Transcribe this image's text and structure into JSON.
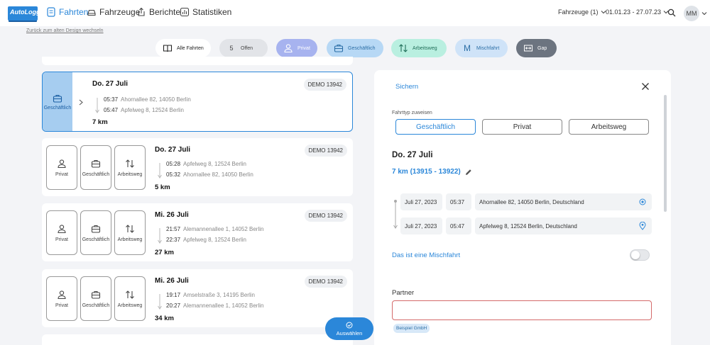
{
  "logo": "AutoLogg",
  "nav": {
    "trips": "Fahrten",
    "vehicles": "Fahrzeuge",
    "reports": "Berichte",
    "stats": "Statistiken"
  },
  "vehicle_filter": "Fahrzeuge (1)",
  "date_range": "01.01.23 - 27.07.23",
  "avatar": "MM",
  "old_design_link": "Zurück zum alten Design wechseln",
  "chips": {
    "all": "Alle Fahrten",
    "open_count": "5",
    "open": "Offen",
    "private": "Privat",
    "business": "Geschäftlich",
    "commute": "Arbeitsweg",
    "mixed_letter": "M",
    "mixed": "Mischfahrt",
    "gap": "Gap"
  },
  "trip_types": {
    "private": "Privat",
    "business": "Geschäftlich",
    "commute": "Arbeitsweg"
  },
  "trips": [
    {
      "date": "Do. 27 Juli",
      "plate": "DEMO 13942",
      "start_time": "05:37",
      "start_addr": "Ahornallee 82, 14050 Berlin",
      "end_time": "05:47",
      "end_addr": "Apfelweg 8, 12524 Berlin",
      "km": "7 km"
    },
    {
      "date": "Do. 27 Juli",
      "plate": "DEMO 13942",
      "start_time": "05:28",
      "start_addr": "Apfelweg 8, 12524 Berlin",
      "end_time": "05:32",
      "end_addr": "Ahornallee 82, 14050 Berlin",
      "km": "5 km"
    },
    {
      "date": "Mi. 26 Juli",
      "plate": "DEMO 13942",
      "start_time": "21:57",
      "start_addr": "Alemannenallee 1, 14052 Berlin",
      "end_time": "22:37",
      "end_addr": "Apfelweg 8, 12524 Berlin",
      "km": "27 km"
    },
    {
      "date": "Mi. 26 Juli",
      "plate": "DEMO 13942",
      "start_time": "19:17",
      "start_addr": "Amselstraße 3, 14195 Berlin",
      "end_time": "20:27",
      "end_addr": "Alemannenallee 1, 14052 Berlin",
      "km": "34 km"
    }
  ],
  "fab": "Auswählen",
  "panel": {
    "save": "Sichern",
    "assign_label": "Fahrttyp zuweisen",
    "date": "Do. 27 Juli",
    "km": "7 km (13915 - 13922)",
    "start_date": "Juli 27, 2023",
    "start_time": "05:37",
    "start_addr": "Ahornallee 82, 14050 Berlin, Deutschland",
    "end_date": "Juli 27, 2023",
    "end_time": "05:47",
    "end_addr": "Apfelweg 8, 12524 Berlin, Deutschland",
    "mixed": "Das ist eine Mischfahrt",
    "partner_label": "Partner",
    "partner_value": "",
    "partner_tag": "Beispiel GmbH"
  },
  "colors": {
    "accent": "#2b87d9",
    "private_chip": "#a7b3ef",
    "business_chip": "#b7d8f5",
    "commute_chip": "#b9efe0",
    "mixed_chip": "#cfe3f8",
    "gap_chip": "#6c7480"
  }
}
